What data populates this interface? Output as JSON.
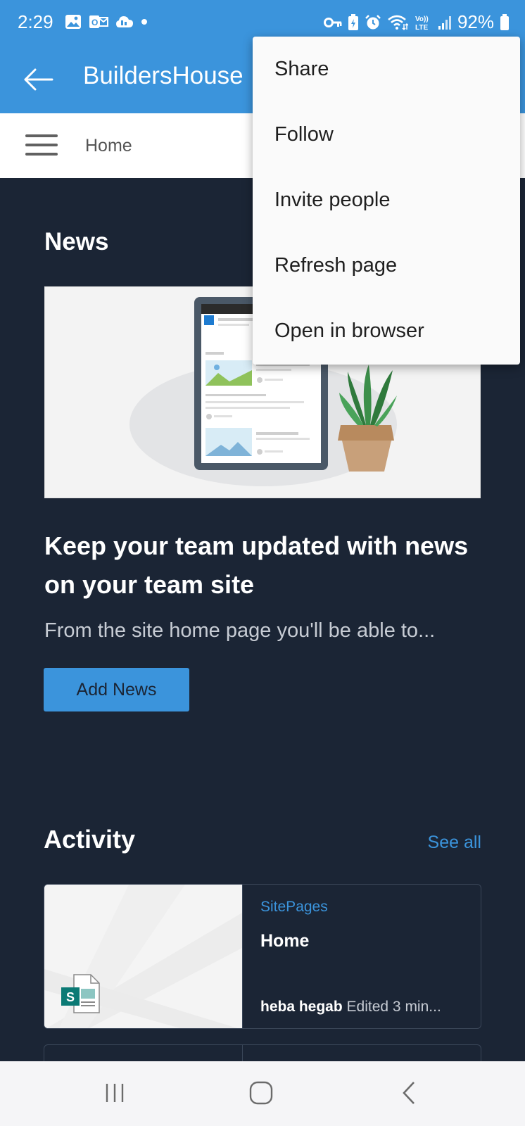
{
  "status_bar": {
    "time": "2:29",
    "battery": "92%",
    "left_icons": [
      "image-icon",
      "outlook-icon",
      "cloud-icon",
      "dot-icon"
    ],
    "right_icons": [
      "key-icon",
      "battery-saver-icon",
      "alarm-icon",
      "wifi-icon",
      "volte-icon",
      "signal-icon",
      "battery-icon"
    ],
    "volte_label": "Vo))\nLTE"
  },
  "app_bar": {
    "title": "BuildersHouse"
  },
  "nav": {
    "home_label": "Home"
  },
  "news": {
    "section_title": "News",
    "headline": "Keep your team updated with news on your team site",
    "description": "From the site home page you'll be able to...",
    "add_button": "Add News"
  },
  "activity": {
    "section_title": "Activity",
    "see_all": "See all",
    "cards": [
      {
        "source": "SitePages",
        "title": "Home",
        "author": "heba hegab",
        "meta": "Edited 3 min...",
        "icon": "sharepoint-page-icon"
      }
    ]
  },
  "overflow_menu": {
    "items": [
      "Share",
      "Follow",
      "Invite people",
      "Refresh page",
      "Open in browser"
    ]
  },
  "colors": {
    "accent": "#3b94dc",
    "background": "#1b2535",
    "menu_bg": "#fafafa"
  }
}
